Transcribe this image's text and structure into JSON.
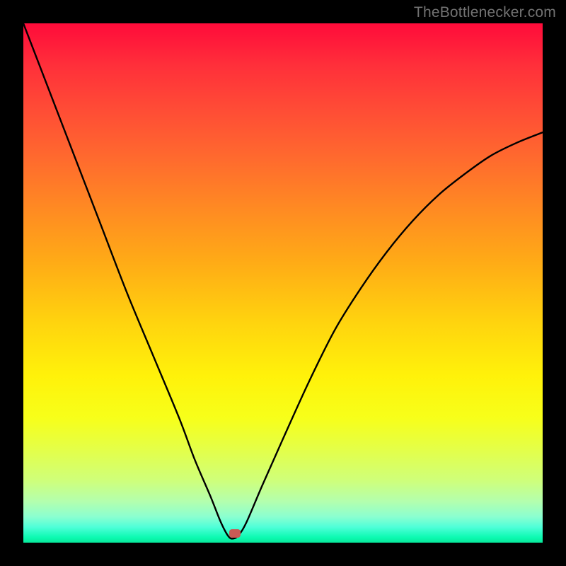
{
  "watermark": "TheBottlenecker.com",
  "marker": {
    "x_pct": 40.8,
    "y_pct": 98.2
  },
  "chart_data": {
    "type": "line",
    "title": "",
    "xlabel": "",
    "ylabel": "",
    "xlim": [
      0,
      100
    ],
    "ylim": [
      0,
      100
    ],
    "series": [
      {
        "name": "bottleneck-curve",
        "x": [
          0,
          5,
          10,
          15,
          20,
          25,
          30,
          33,
          36,
          38,
          39.5,
          40.5,
          41.5,
          43,
          46,
          50,
          55,
          60,
          65,
          70,
          75,
          80,
          85,
          90,
          95,
          100
        ],
        "y": [
          100,
          87,
          74,
          61,
          48,
          36,
          24,
          16,
          9,
          4,
          1.2,
          0.8,
          1.5,
          4,
          11,
          20,
          31,
          41,
          49,
          56,
          62,
          67,
          71,
          74.5,
          77,
          79
        ]
      }
    ],
    "annotations": [
      {
        "name": "optimal-point",
        "x": 40.8,
        "y": 1.8
      }
    ]
  }
}
